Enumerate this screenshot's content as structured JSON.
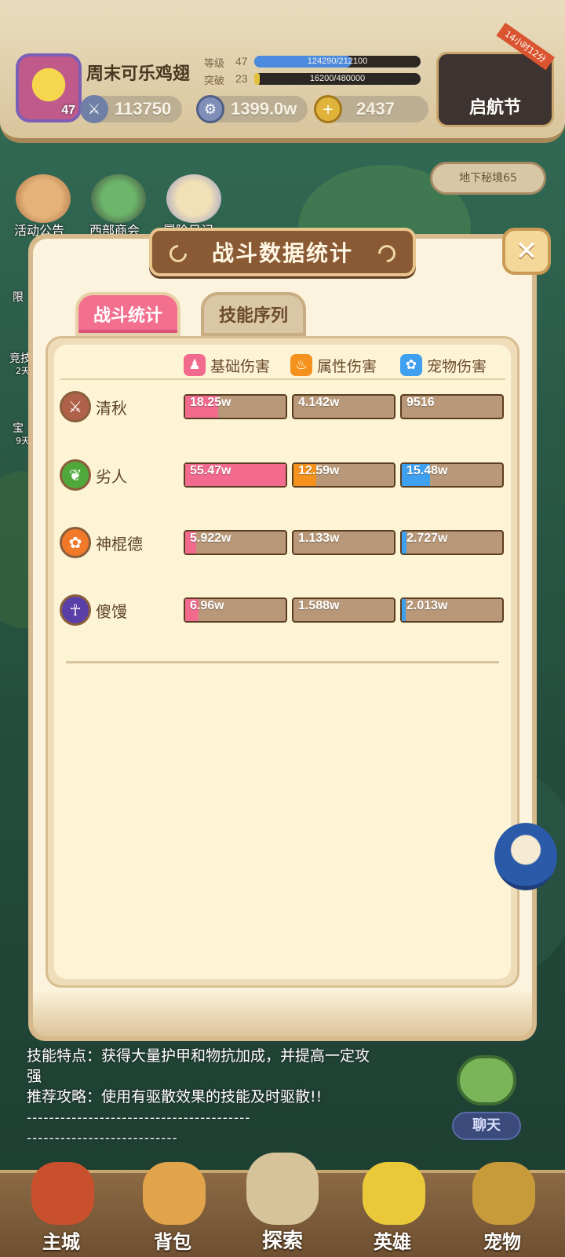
{
  "player": {
    "name": "周末可乐鸡翅",
    "avatar_level": "47",
    "level_label": "等级",
    "level_value": "47",
    "level_exp": "124290/212100",
    "level_progress": 0.586,
    "break_label": "突破",
    "break_value": "23",
    "break_exp": "16200/480000",
    "break_progress": 0.034,
    "power": "113750",
    "silver": "1399.0w",
    "gold": "2437"
  },
  "event": {
    "name": "启航节",
    "countdown": "14小时12分"
  },
  "quick_icons": [
    "活动公告",
    "西部商会",
    "冒险日记"
  ],
  "side_labels": [
    "限",
    "竞技",
    "2天",
    "宝",
    "9天"
  ],
  "dungeon": "地下秘境65",
  "modal": {
    "title": "战斗数据统计",
    "tabs": [
      "战斗统计",
      "技能序列"
    ],
    "headers": {
      "base": "基础伤害",
      "elem": "属性伤害",
      "pet": "宠物伤害"
    },
    "colors": {
      "base": "#f26a8d",
      "elem": "#f5921e",
      "pet": "#3fa0ef"
    },
    "rows": [
      {
        "name": "清秋",
        "icon": "warrior-class-icon",
        "icon_color": "#b0614a",
        "base": "18.25w",
        "base_frac": 0.33,
        "elem": "4.142w",
        "elem_frac": 0.0,
        "pet": "9516",
        "pet_frac": 0.0
      },
      {
        "name": "劣人",
        "icon": "ranger-class-icon",
        "icon_color": "#4ea93a",
        "base": "55.47w",
        "base_frac": 1.0,
        "elem": "12.59w",
        "elem_frac": 0.23,
        "pet": "15.48w",
        "pet_frac": 0.28
      },
      {
        "name": "神棍德",
        "icon": "paw-class-icon",
        "icon_color": "#f07a2a",
        "base": "5.922w",
        "base_frac": 0.11,
        "elem": "1.133w",
        "elem_frac": 0.0,
        "pet": "2.727w",
        "pet_frac": 0.05
      },
      {
        "name": "傻馒",
        "icon": "mage-class-icon",
        "icon_color": "#5a3fa8",
        "base": "6.96w",
        "base_frac": 0.13,
        "elem": "1.588w",
        "elem_frac": 0.0,
        "pet": "2.013w",
        "pet_frac": 0.04
      }
    ]
  },
  "boss_info": {
    "line1": "技能特点：获得大量护甲和物抗加成，并提高一定攻",
    "line2": "强",
    "line3": "推荐攻略：使用有驱散效果的技能及时驱散!!",
    "line4": "----------------------------------------",
    "line5": "---------------------------"
  },
  "chat": "聊天",
  "nav": [
    "主城",
    "背包",
    "探索",
    "英雄",
    "宠物"
  ]
}
